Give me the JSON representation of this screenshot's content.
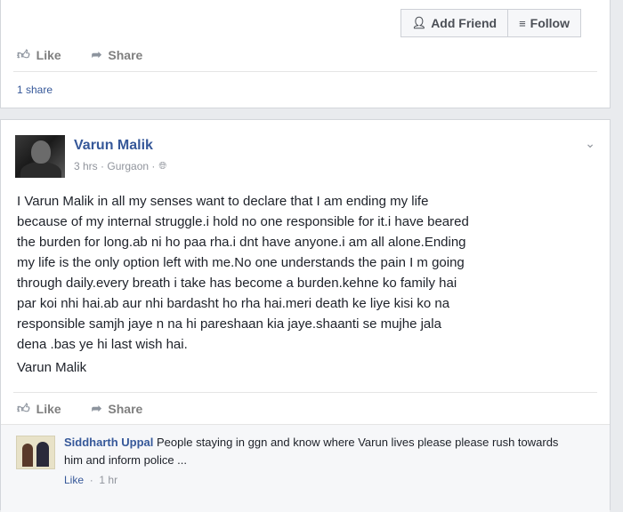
{
  "top_post": {
    "add_friend_label": "Add Friend",
    "add_friend_icon": "person-plus-icon",
    "follow_label": "Follow",
    "follow_icon": "rss-icon",
    "like_label": "Like",
    "share_label": "Share",
    "shares_text": "1 share"
  },
  "post": {
    "author": "Varun Malik",
    "time": "3 hrs",
    "separator": "·",
    "location": "Gurgaon",
    "audience_icon": "globe-icon",
    "body": "I Varun Malik in all my senses want to declare that I am ending my life\nbecause of my internal struggle.i hold no one responsible for it.i have beared\nthe burden for long.ab ni ho paa rha.i dnt have anyone.i am all alone.Ending\nmy life is the only option left with me.No one understands the pain I m going\nthrough daily.every breath i take has become a burden.kehne ko family hai\npar koi nhi hai.ab aur nhi bardasht ho rha hai.meri death ke liye kisi ko na\nresponsible samjh jaye n na hi pareshaan kia jaye.shaanti se mujhe jala\ndena .bas ye hi last wish hai.",
    "signature": "Varun Malik",
    "like_label": "Like",
    "share_label": "Share"
  },
  "comment": {
    "author": "Siddharth Uppal",
    "text": "People staying in ggn and know where Varun lives please please rush towards him and inform police ...",
    "like_label": "Like",
    "separator": "·",
    "time": "1 hr"
  },
  "colors": {
    "link_blue": "#365899",
    "page_bg": "#e9ebee",
    "card_bg": "#ffffff",
    "muted": "#90949c"
  }
}
